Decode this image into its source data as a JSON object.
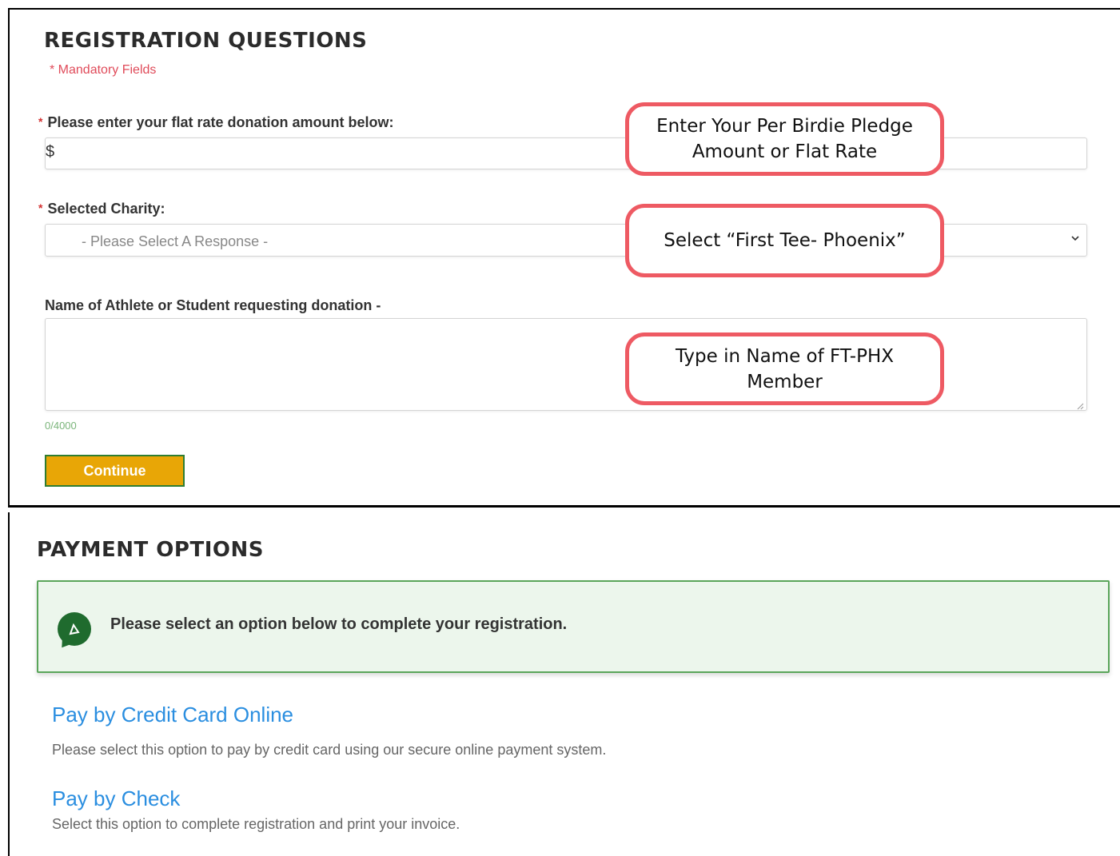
{
  "registration": {
    "title": "REGISTRATION QUESTIONS",
    "mandatory_note": "* Mandatory Fields",
    "donation_label": "Please enter your flat rate donation amount below:",
    "donation_prefix": "$",
    "donation_value": "",
    "charity_label": "Selected Charity:",
    "charity_placeholder": "- Please Select A Response -",
    "athlete_label": "Name of Athlete or Student requesting donation -",
    "athlete_value": "",
    "char_counter": "0/4000",
    "continue_label": "Continue",
    "required_mark": "*"
  },
  "callouts": {
    "pledge_line1": "Enter Your Per Birdie Pledge",
    "pledge_line2": "Amount or Flat Rate",
    "charity": "Select “First Tee- Phoenix”",
    "member_line1": "Type in Name of FT-PHX",
    "member_line2": "Member"
  },
  "payment": {
    "title": "PAYMENT OPTIONS",
    "info_text": "Please select an option below to complete your registration.",
    "options": [
      {
        "title": "Pay by Credit Card Online",
        "description": "Please select this option to pay by credit card using our secure online payment system."
      },
      {
        "title": "Pay by Check",
        "description": "Select this option to complete registration and print your invoice."
      }
    ]
  },
  "colors": {
    "accent_button": "#e8a606",
    "callout_border": "#ee5a63",
    "link": "#2a8ee0",
    "info_background": "#ecf6ec"
  },
  "icons": {
    "info": "chat-bubble-icon",
    "select_arrow": "chevron-down-icon",
    "resize": "resize-handle-icon"
  }
}
